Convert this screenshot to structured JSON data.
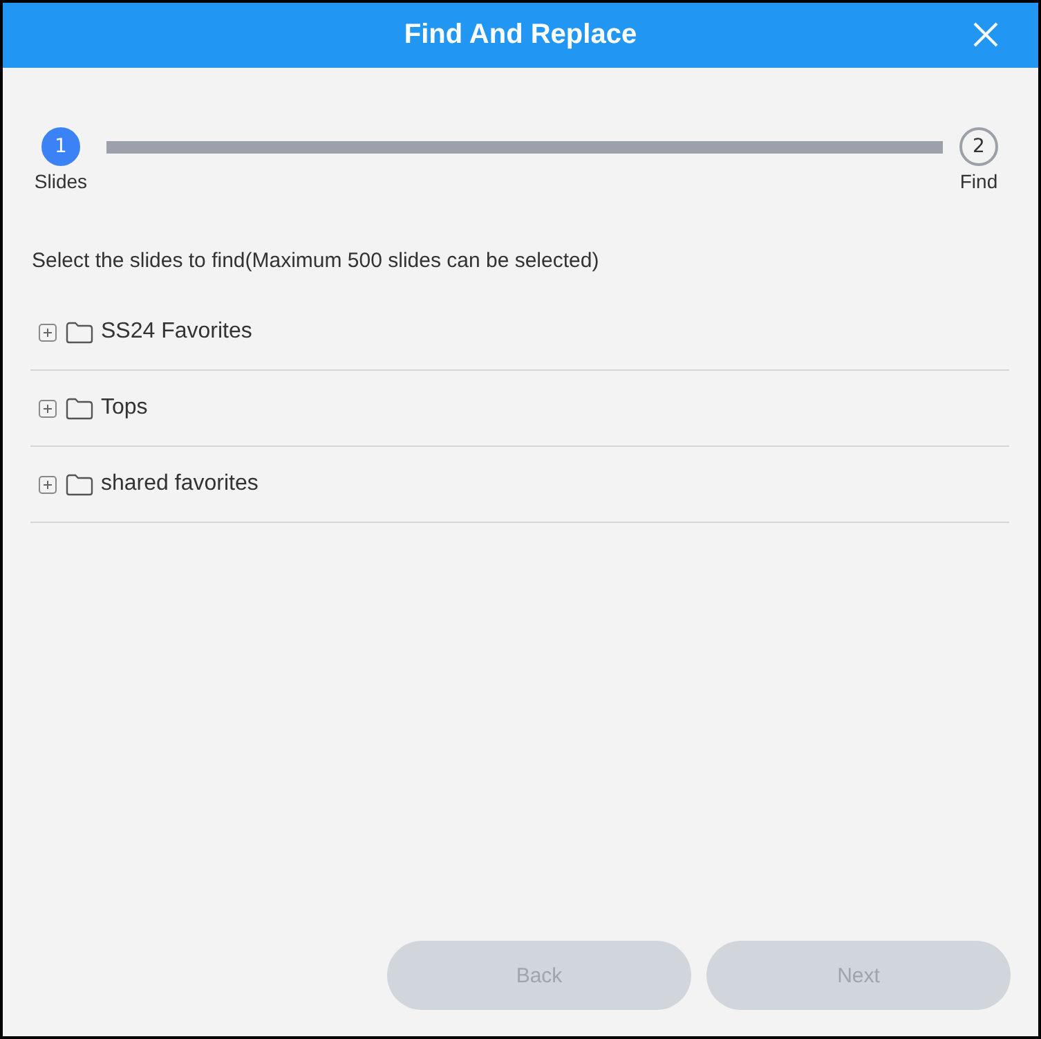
{
  "window": {
    "title": "Find And Replace"
  },
  "stepper": {
    "steps": [
      {
        "number": "1",
        "label": "Slides",
        "selected": true
      },
      {
        "number": "2",
        "label": "Find",
        "selected": false
      }
    ]
  },
  "instruction": "Select the slides to find(Maximum 500 slides can be selected)",
  "tree": {
    "items": [
      {
        "label": "SS24 Favorites",
        "expanded": false
      },
      {
        "label": "Tops",
        "expanded": false
      },
      {
        "label": "shared favorites",
        "expanded": false
      }
    ]
  },
  "buttons": [
    {
      "label": "Back",
      "disabled": true
    },
    {
      "label": "Next",
      "disabled": true
    }
  ]
}
